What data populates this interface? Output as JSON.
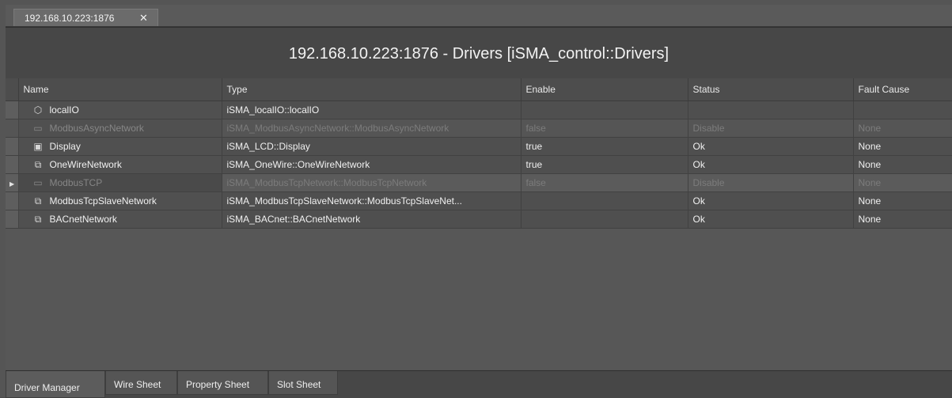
{
  "doc_tab": {
    "label": "192.168.10.223:1876",
    "close": "✕"
  },
  "title": "192.168.10.223:1876 - Drivers [iSMA_control::Drivers]",
  "columns": [
    "Name",
    "Type",
    "Enable",
    "Status",
    "Fault Cause"
  ],
  "rows": [
    {
      "icon": "box-icon",
      "glyph": "⬡",
      "name": "localIO",
      "type": "iSMA_localIO::localIO",
      "enable": "",
      "status": "",
      "fault": ""
    },
    {
      "icon": "network-icon",
      "glyph": "▭",
      "name": "ModbusAsyncNetwork",
      "type": "iSMA_ModbusAsyncNetwork::ModbusAsyncNetwork",
      "enable": "false",
      "status": "Disable",
      "fault": "None"
    },
    {
      "icon": "display-icon",
      "glyph": "▣",
      "name": "Display",
      "type": "iSMA_LCD::Display",
      "enable": "true",
      "status": "Ok",
      "fault": "None"
    },
    {
      "icon": "folder-icon",
      "glyph": "⧉",
      "name": "OneWireNetwork",
      "type": "iSMA_OneWire::OneWireNetwork",
      "enable": "true",
      "status": "Ok",
      "fault": "None"
    },
    {
      "icon": "network-icon",
      "glyph": "▭",
      "name": "ModbusTCP",
      "type": "iSMA_ModbusTcpNetwork::ModbusTcpNetwork",
      "enable": "false",
      "status": "Disable",
      "fault": "None"
    },
    {
      "icon": "folder-icon",
      "glyph": "⧉",
      "name": "ModbusTcpSlaveNetwork",
      "type": "iSMA_ModbusTcpSlaveNetwork::ModbusTcpSlaveNet...",
      "enable": "",
      "status": "Ok",
      "fault": "None"
    },
    {
      "icon": "folder-icon",
      "glyph": "⧉",
      "name": "BACnetNetwork",
      "type": "iSMA_BACnet::BACnetNetwork",
      "enable": "",
      "status": "Ok",
      "fault": "None"
    }
  ],
  "bottom_tabs": [
    "Driver Manager",
    "Wire Sheet",
    "Property Sheet",
    "Slot Sheet"
  ]
}
